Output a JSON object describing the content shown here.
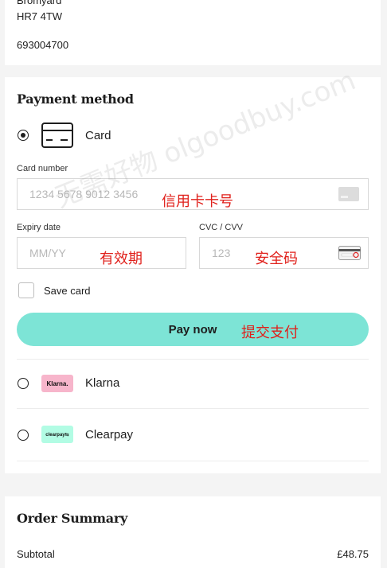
{
  "address": {
    "line1": "Bromyard",
    "postcode": "HR7 4TW",
    "phone": "693004700"
  },
  "payment": {
    "title": "Payment method",
    "card_option_label": "Card",
    "card_number": {
      "label": "Card number",
      "placeholder": "1234 5678 9012 3456",
      "annotation": "信用卡卡号"
    },
    "expiry": {
      "label": "Expiry date",
      "placeholder": "MM/YY",
      "annotation": "有效期"
    },
    "cvc": {
      "label": "CVC / CVV",
      "placeholder": "123",
      "annotation": "安全码"
    },
    "save_card_label": "Save card",
    "pay_button_label": "Pay now",
    "pay_annotation": "提交支付",
    "klarna": {
      "label": "Klarna",
      "badge_text": "Klarna."
    },
    "clearpay": {
      "label": "Clearpay",
      "badge_text": "clearpay⇆"
    }
  },
  "watermark_text": "无需好物 olgoodbuy.com",
  "summary": {
    "title": "Order Summary",
    "subtotal_label": "Subtotal",
    "subtotal_value": "£48.75"
  },
  "colors": {
    "pay_button": "#7de4d6",
    "annotation_red": "#e0201b",
    "klarna_pink": "#f7b5cb",
    "clearpay_mint": "#b2fce4"
  }
}
